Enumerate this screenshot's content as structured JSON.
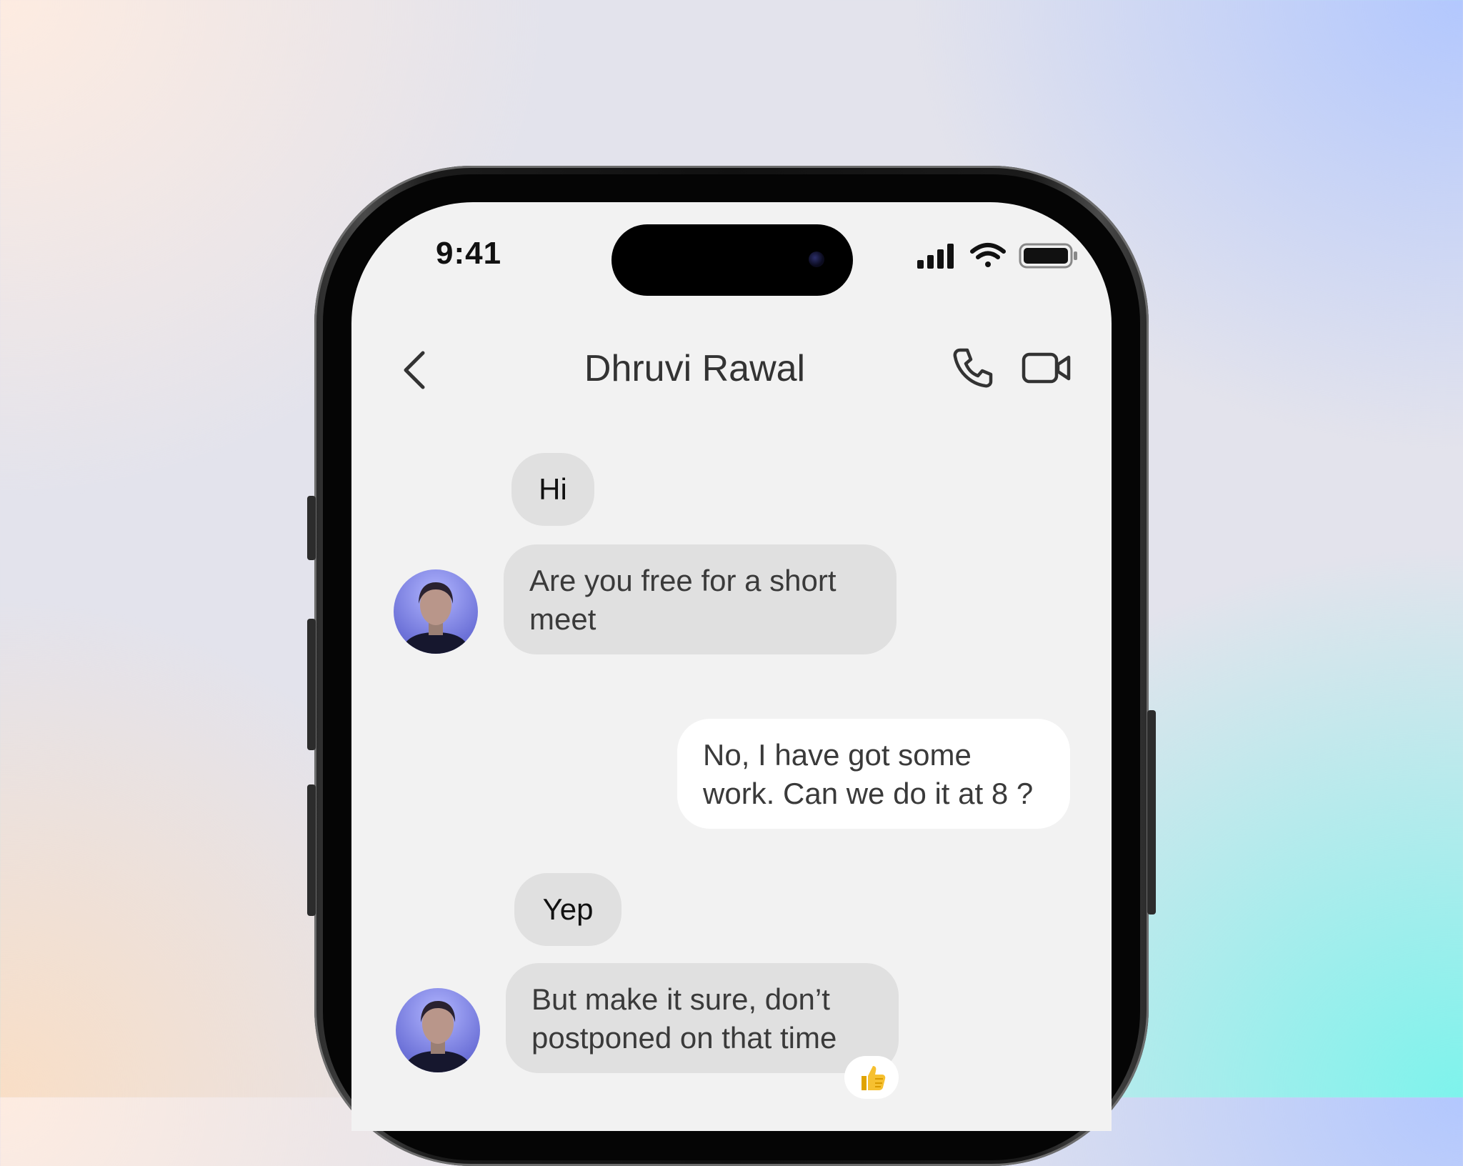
{
  "status_bar": {
    "time": "9:41"
  },
  "chat": {
    "contact_name": "Dhruvi Rawal",
    "messages": [
      {
        "direction": "incoming",
        "text": "Hi"
      },
      {
        "direction": "incoming",
        "text": "Are you free for a short meet"
      },
      {
        "direction": "outgoing",
        "text": "No, I have got some work. Can we do it at 8 ?"
      },
      {
        "direction": "incoming",
        "text": "Yep"
      },
      {
        "direction": "incoming",
        "text": "But make it sure, don’t postponed on that time",
        "reaction": "thumbs-up"
      }
    ]
  },
  "icons": {
    "back": "chevron-left-icon",
    "call": "phone-icon",
    "video": "video-camera-icon",
    "signal": "cellular-signal-icon",
    "wifi": "wifi-icon",
    "battery": "battery-icon",
    "reaction": "thumbs-up-icon"
  },
  "colors": {
    "screen_background": "#f2f2f2",
    "incoming_bubble": "#e0e0e0",
    "outgoing_bubble": "#ffffff",
    "avatar_background": "#7c80e6"
  }
}
